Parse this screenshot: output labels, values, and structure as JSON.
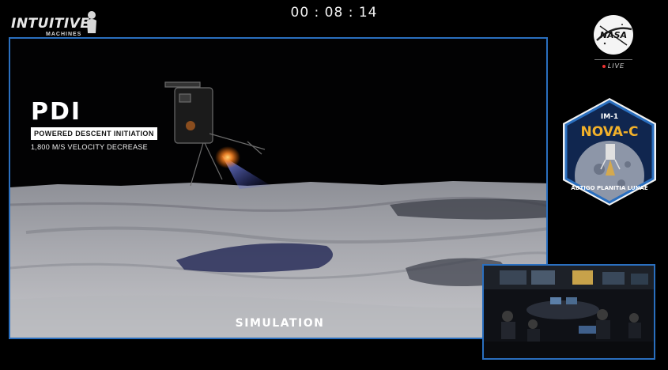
{
  "brand": {
    "name": "INTUITIVE",
    "sub": "MACHINES"
  },
  "timer": "00 : 08 : 14",
  "broadcast": {
    "network": "NASA",
    "live_label": "LIVE",
    "live_color": "#e33333"
  },
  "overlay": {
    "title": "PDI",
    "subtitle": "POWERED DESCENT INITIATION",
    "detail": "1,800 M/S VELOCITY DECREASE"
  },
  "simulation_label": "SIMULATION",
  "patch": {
    "mission": "IM-1",
    "name": "NOVA-C",
    "motto": "ADTIGO PLANITIA LUNAE"
  },
  "colors": {
    "frame": "#2a6fbf",
    "patch_gold": "#f2b12a",
    "patch_navy": "#10264f"
  },
  "icons": {
    "nasa_logo": "nasa-meatball-icon",
    "brand_figure": "brand-figure-icon"
  }
}
